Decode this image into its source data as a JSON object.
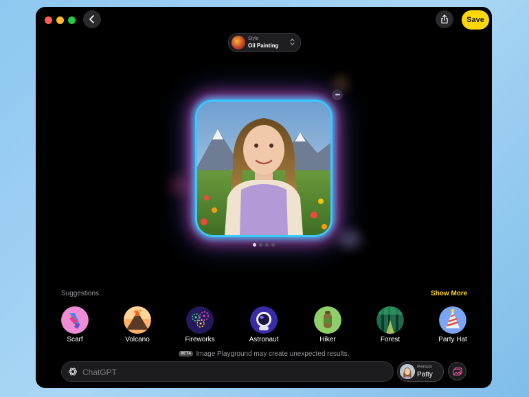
{
  "toolbar": {
    "save_label": "Save"
  },
  "style": {
    "label": "Style",
    "value": "Oil Painting"
  },
  "suggestions": {
    "title": "Suggestions",
    "show_more": "Show More",
    "items": [
      {
        "label": "Scarf",
        "icon": "scarf-icon"
      },
      {
        "label": "Volcano",
        "icon": "volcano-icon"
      },
      {
        "label": "Fireworks",
        "icon": "fireworks-icon"
      },
      {
        "label": "Astronaut",
        "icon": "astronaut-icon"
      },
      {
        "label": "Hiker",
        "icon": "hiker-icon"
      },
      {
        "label": "Forest",
        "icon": "forest-icon"
      },
      {
        "label": "Party Hat",
        "icon": "party-hat-icon"
      }
    ]
  },
  "preview": {
    "page_count": 4,
    "current_page": 1
  },
  "disclaimer": {
    "badge": "BETA",
    "text": "Image Playground may create unexpected results."
  },
  "prompt": {
    "placeholder": "ChatGPT"
  },
  "person": {
    "label": "Person",
    "name": "Patty"
  },
  "colors": {
    "accent": "#ffd60a",
    "window_bg": "#000000",
    "close": "#ff5f57",
    "minimize": "#febc2e",
    "maximize": "#28c840"
  }
}
